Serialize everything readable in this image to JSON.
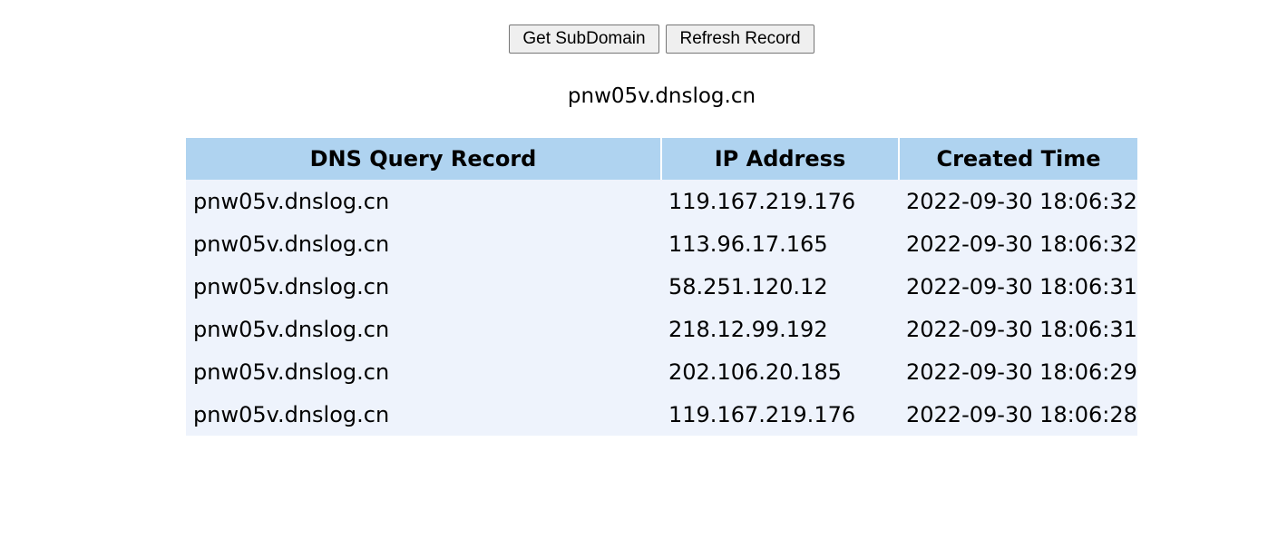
{
  "toolbar": {
    "get_subdomain_label": "Get SubDomain",
    "refresh_record_label": "Refresh Record"
  },
  "subdomain": "pnw05v.dnslog.cn",
  "table": {
    "headers": [
      "DNS Query Record",
      "IP Address",
      "Created Time"
    ],
    "rows": [
      {
        "record": "pnw05v.dnslog.cn",
        "ip": "119.167.219.176",
        "time": "2022-09-30 18:06:32"
      },
      {
        "record": "pnw05v.dnslog.cn",
        "ip": "113.96.17.165",
        "time": "2022-09-30 18:06:32"
      },
      {
        "record": "pnw05v.dnslog.cn",
        "ip": "58.251.120.12",
        "time": "2022-09-30 18:06:31"
      },
      {
        "record": "pnw05v.dnslog.cn",
        "ip": "218.12.99.192",
        "time": "2022-09-30 18:06:31"
      },
      {
        "record": "pnw05v.dnslog.cn",
        "ip": "202.106.20.185",
        "time": "2022-09-30 18:06:29"
      },
      {
        "record": "pnw05v.dnslog.cn",
        "ip": "119.167.219.176",
        "time": "2022-09-30 18:06:28"
      }
    ]
  },
  "colors": {
    "header_bg": "#afd3f0",
    "table_bg": "#eef3fc",
    "button_bg": "#efefef"
  }
}
